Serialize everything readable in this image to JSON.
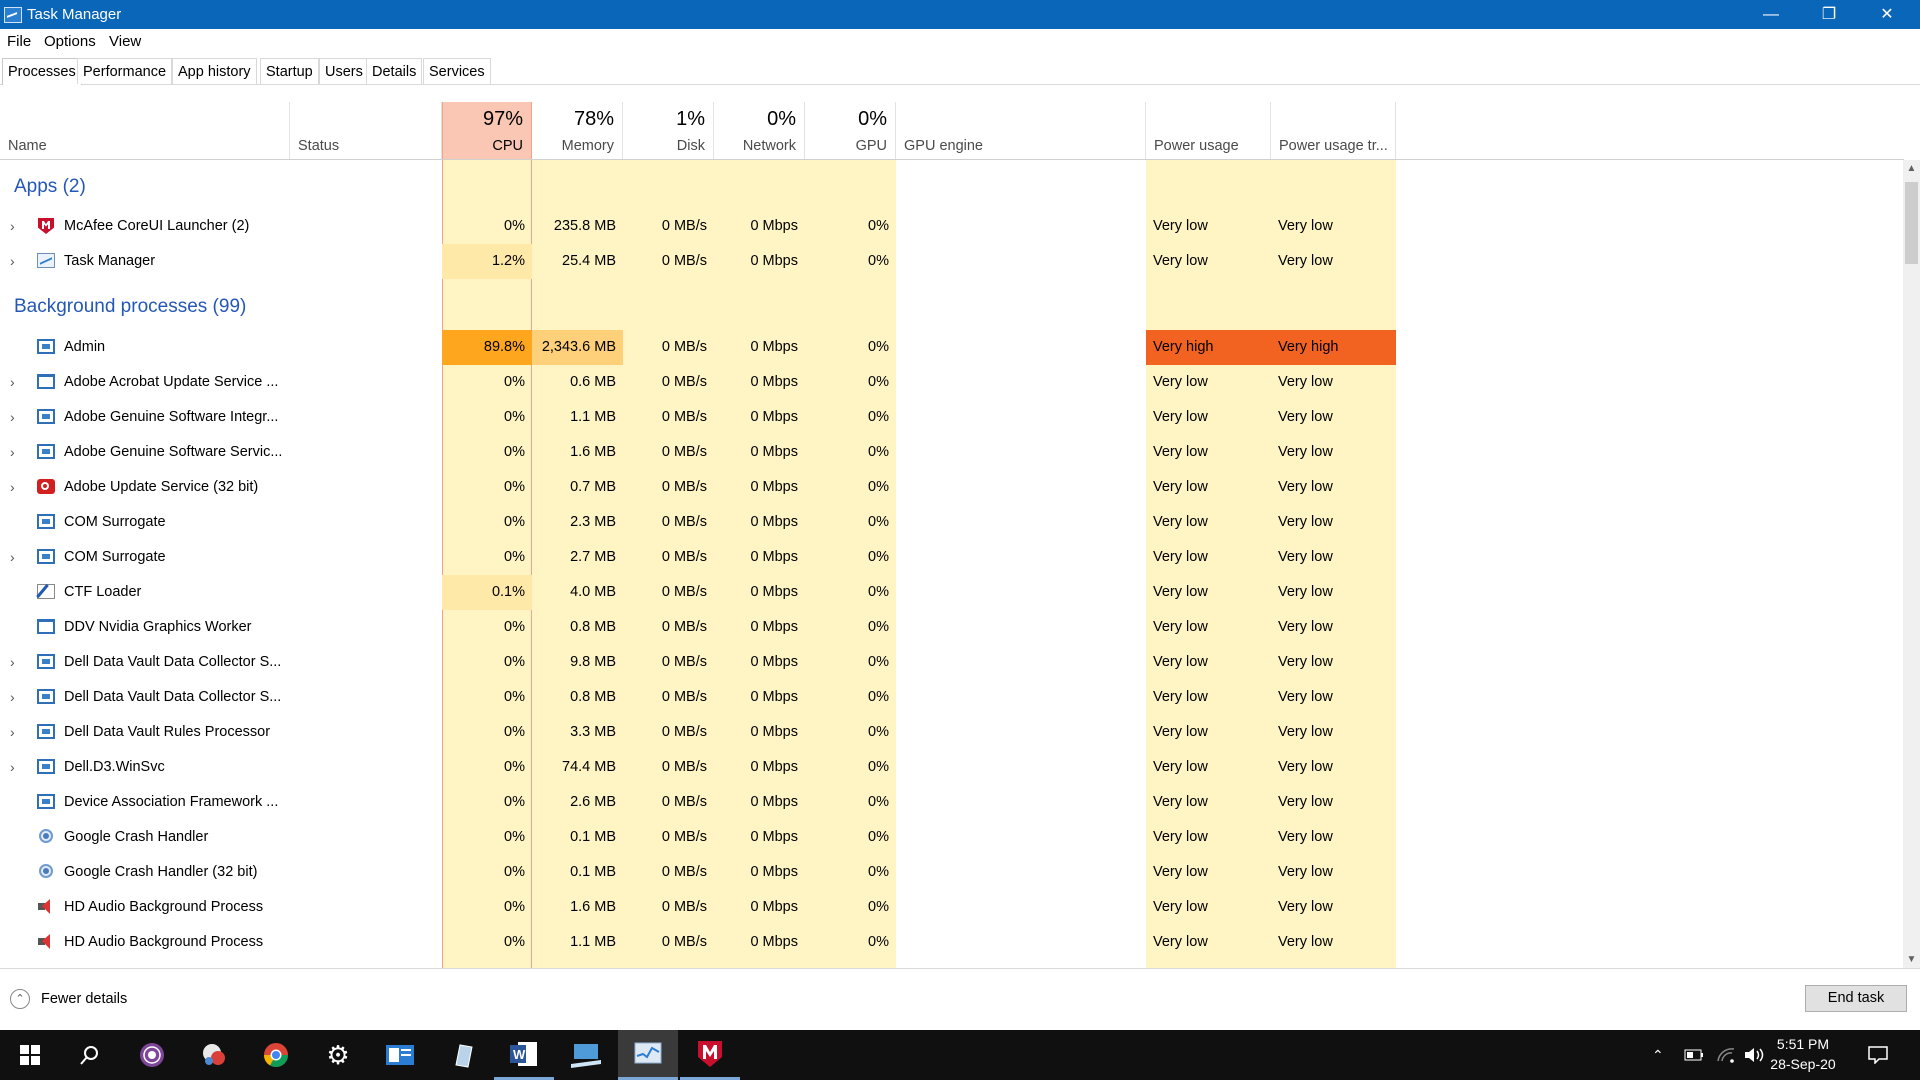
{
  "window": {
    "title": "Task Manager",
    "controls": [
      "—",
      "❐",
      "✕"
    ]
  },
  "menu": [
    "File",
    "Options",
    "View"
  ],
  "tabs": [
    "Processes",
    "Performance",
    "App history",
    "Startup",
    "Users",
    "Details",
    "Services"
  ],
  "columns": {
    "name": "Name",
    "status": "Status",
    "cpu": {
      "pct": "97%",
      "label": "CPU"
    },
    "memory": {
      "pct": "78%",
      "label": "Memory"
    },
    "disk": {
      "pct": "1%",
      "label": "Disk"
    },
    "network": {
      "pct": "0%",
      "label": "Network"
    },
    "gpu": {
      "pct": "0%",
      "label": "GPU"
    },
    "gpu_engine": "GPU engine",
    "power": "Power usage",
    "power_trend": "Power usage tr..."
  },
  "groups": {
    "apps": "Apps (2)",
    "background": "Background processes (99)"
  },
  "apps": [
    {
      "name": "McAfee CoreUI Launcher (2)",
      "expand": true,
      "icon": "mcafee-icon",
      "cpu": "0%",
      "mem": "235.8 MB",
      "disk": "0 MB/s",
      "net": "0 Mbps",
      "gpu": "0%",
      "power": "Very low",
      "trend": "Very low"
    },
    {
      "name": "Task Manager",
      "expand": true,
      "icon": "task-manager-icon",
      "cpu": "1.2%",
      "mem": "25.4 MB",
      "disk": "0 MB/s",
      "net": "0 Mbps",
      "gpu": "0%",
      "power": "Very low",
      "trend": "Very low"
    }
  ],
  "background": [
    {
      "name": "Admin",
      "expand": false,
      "icon": "window-icon",
      "cpu": "89.8%",
      "mem": "2,343.6 MB",
      "disk": "0 MB/s",
      "net": "0 Mbps",
      "gpu": "0%",
      "power": "Very high",
      "trend": "Very high",
      "hot": true
    },
    {
      "name": "Adobe Acrobat Update Service ...",
      "expand": true,
      "icon": "frame-icon",
      "cpu": "0%",
      "mem": "0.6 MB",
      "disk": "0 MB/s",
      "net": "0 Mbps",
      "gpu": "0%",
      "power": "Very low",
      "trend": "Very low"
    },
    {
      "name": "Adobe Genuine Software Integr...",
      "expand": true,
      "icon": "window-icon",
      "cpu": "0%",
      "mem": "1.1 MB",
      "disk": "0 MB/s",
      "net": "0 Mbps",
      "gpu": "0%",
      "power": "Very low",
      "trend": "Very low"
    },
    {
      "name": "Adobe Genuine Software Servic...",
      "expand": true,
      "icon": "window-icon",
      "cpu": "0%",
      "mem": "1.6 MB",
      "disk": "0 MB/s",
      "net": "0 Mbps",
      "gpu": "0%",
      "power": "Very low",
      "trend": "Very low"
    },
    {
      "name": "Adobe Update Service (32 bit)",
      "expand": true,
      "icon": "adobe-icon",
      "cpu": "0%",
      "mem": "0.7 MB",
      "disk": "0 MB/s",
      "net": "0 Mbps",
      "gpu": "0%",
      "power": "Very low",
      "trend": "Very low"
    },
    {
      "name": "COM Surrogate",
      "expand": false,
      "icon": "window-icon",
      "cpu": "0%",
      "mem": "2.3 MB",
      "disk": "0 MB/s",
      "net": "0 Mbps",
      "gpu": "0%",
      "power": "Very low",
      "trend": "Very low"
    },
    {
      "name": "COM Surrogate",
      "expand": true,
      "icon": "window-icon",
      "cpu": "0%",
      "mem": "2.7 MB",
      "disk": "0 MB/s",
      "net": "0 Mbps",
      "gpu": "0%",
      "power": "Very low",
      "trend": "Very low"
    },
    {
      "name": "CTF Loader",
      "expand": false,
      "icon": "ctf-icon",
      "cpu": "0.1%",
      "mem": "4.0 MB",
      "disk": "0 MB/s",
      "net": "0 Mbps",
      "gpu": "0%",
      "power": "Very low",
      "trend": "Very low"
    },
    {
      "name": "DDV Nvidia Graphics Worker",
      "expand": false,
      "icon": "frame-icon",
      "cpu": "0%",
      "mem": "0.8 MB",
      "disk": "0 MB/s",
      "net": "0 Mbps",
      "gpu": "0%",
      "power": "Very low",
      "trend": "Very low"
    },
    {
      "name": "Dell Data Vault Data Collector S...",
      "expand": true,
      "icon": "window-icon",
      "cpu": "0%",
      "mem": "9.8 MB",
      "disk": "0 MB/s",
      "net": "0 Mbps",
      "gpu": "0%",
      "power": "Very low",
      "trend": "Very low"
    },
    {
      "name": "Dell Data Vault Data Collector S...",
      "expand": true,
      "icon": "window-icon",
      "cpu": "0%",
      "mem": "0.8 MB",
      "disk": "0 MB/s",
      "net": "0 Mbps",
      "gpu": "0%",
      "power": "Very low",
      "trend": "Very low"
    },
    {
      "name": "Dell Data Vault Rules Processor",
      "expand": true,
      "icon": "window-icon",
      "cpu": "0%",
      "mem": "3.3 MB",
      "disk": "0 MB/s",
      "net": "0 Mbps",
      "gpu": "0%",
      "power": "Very low",
      "trend": "Very low"
    },
    {
      "name": "Dell.D3.WinSvc",
      "expand": true,
      "icon": "window-icon",
      "cpu": "0%",
      "mem": "74.4 MB",
      "disk": "0 MB/s",
      "net": "0 Mbps",
      "gpu": "0%",
      "power": "Very low",
      "trend": "Very low"
    },
    {
      "name": "Device Association Framework ...",
      "expand": false,
      "icon": "window-icon",
      "cpu": "0%",
      "mem": "2.6 MB",
      "disk": "0 MB/s",
      "net": "0 Mbps",
      "gpu": "0%",
      "power": "Very low",
      "trend": "Very low"
    },
    {
      "name": "Google Crash Handler",
      "expand": false,
      "icon": "google-update-icon",
      "cpu": "0%",
      "mem": "0.1 MB",
      "disk": "0 MB/s",
      "net": "0 Mbps",
      "gpu": "0%",
      "power": "Very low",
      "trend": "Very low"
    },
    {
      "name": "Google Crash Handler (32 bit)",
      "expand": false,
      "icon": "google-update-icon",
      "cpu": "0%",
      "mem": "0.1 MB",
      "disk": "0 MB/s",
      "net": "0 Mbps",
      "gpu": "0%",
      "power": "Very low",
      "trend": "Very low"
    },
    {
      "name": "HD Audio Background Process",
      "expand": false,
      "icon": "speaker-icon",
      "cpu": "0%",
      "mem": "1.6 MB",
      "disk": "0 MB/s",
      "net": "0 Mbps",
      "gpu": "0%",
      "power": "Very low",
      "trend": "Very low"
    },
    {
      "name": "HD Audio Background Process",
      "expand": false,
      "icon": "speaker-icon",
      "cpu": "0%",
      "mem": "1.1 MB",
      "disk": "0 MB/s",
      "net": "0 Mbps",
      "gpu": "0%",
      "power": "Very low",
      "trend": "Very low"
    }
  ],
  "footer": {
    "fewer_details": "Fewer details",
    "end_task": "End task"
  },
  "taskbar": {
    "apps": [
      "start-icon",
      "search-icon",
      "tor-browser-icon",
      "network-globe-icon",
      "chrome-icon",
      "settings-icon",
      "outlook-icon",
      "paint-3d-icon",
      "word-icon",
      "remote-desktop-icon",
      "task-manager-icon",
      "mcafee-icon"
    ],
    "clock": {
      "time": "5:51 PM",
      "date": "28-Sep-20"
    }
  },
  "colors": {
    "titlebar": "#0a66b8",
    "low": "#fff4c4",
    "header_cpu": "#f9c7b3",
    "hot_cpu": "#ffa61f",
    "hot_mem": "#ffd07a",
    "very_high": "#f26322",
    "group_text": "#2457b6"
  }
}
